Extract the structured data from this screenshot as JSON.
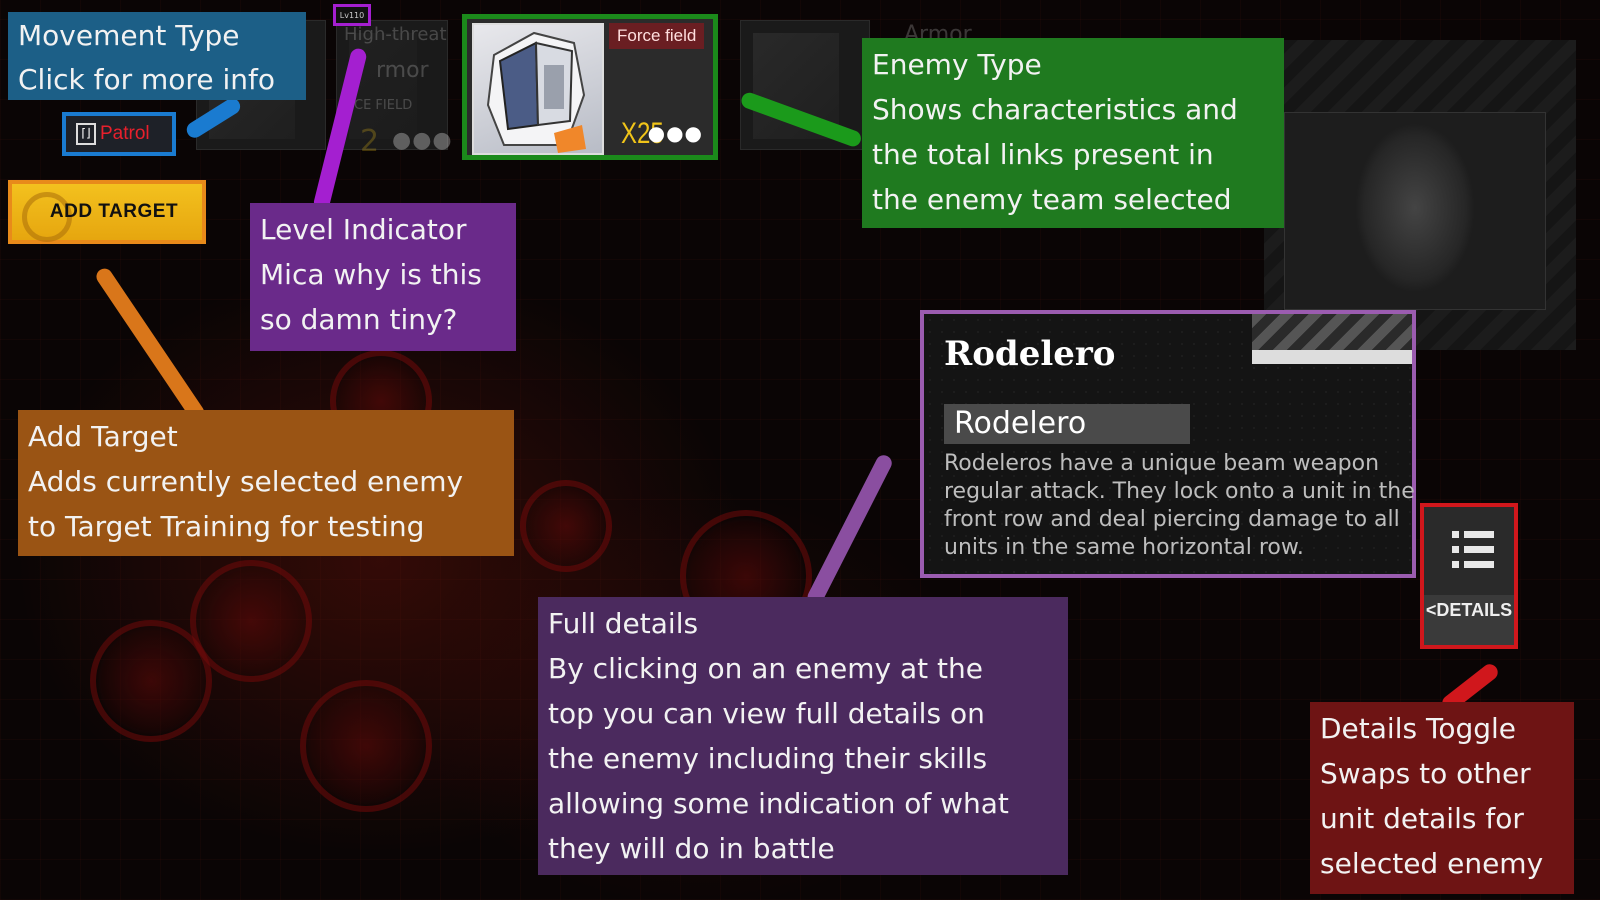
{
  "top_bar": {
    "level_label": "Lv110",
    "ghost_threat": "High-threat",
    "ghost_armor": "rmor",
    "ghost_field": "CE FIELD",
    "ghost_armor_right": "Armor",
    "ghost_count": "2"
  },
  "selected_enemy": {
    "trait": "Force field",
    "count": "X25",
    "more": "●●●"
  },
  "patrol_button": {
    "label": "Patrol",
    "icon": "movement-type-icon"
  },
  "add_target_button": {
    "label": "ADD TARGET"
  },
  "details_panel": {
    "title": "Rodelero",
    "name": "Rodelero",
    "description_lines": [
      "Rodeleros have a unique beam weapon",
      "regular attack. They lock onto a unit in the",
      "front row and deal piercing damage to all",
      "units in the same horizontal row."
    ]
  },
  "details_toggle": {
    "label": "<DETAILS",
    "icon": "menu-list-icon"
  },
  "annotations": {
    "movement_type": [
      "Movement Type",
      "Click for more info"
    ],
    "level_indicator": [
      "Level Indicator",
      "Mica why is this",
      "so damn tiny?"
    ],
    "enemy_type": [
      "Enemy Type",
      "Shows characteristics and",
      "the total links present in",
      "the enemy team selected"
    ],
    "add_target": [
      "Add Target",
      "Adds currently selected enemy",
      "to Target Training for testing"
    ],
    "full_details": [
      "Full details",
      "By clicking on an enemy at the",
      "top you can view full details on",
      "the enemy including their skills",
      "allowing some indication of what",
      "they will do in battle"
    ],
    "details_toggle": [
      "Details Toggle",
      "Swaps to other",
      "unit details for",
      "selected enemy"
    ]
  },
  "colors": {
    "movement": "#1c5f87",
    "level": "#6a2a8a",
    "enemy_type": "#1f7a1f",
    "add_target": "#9a5414",
    "full_details": "#4b2a5e",
    "toggle": "#6e1414"
  }
}
